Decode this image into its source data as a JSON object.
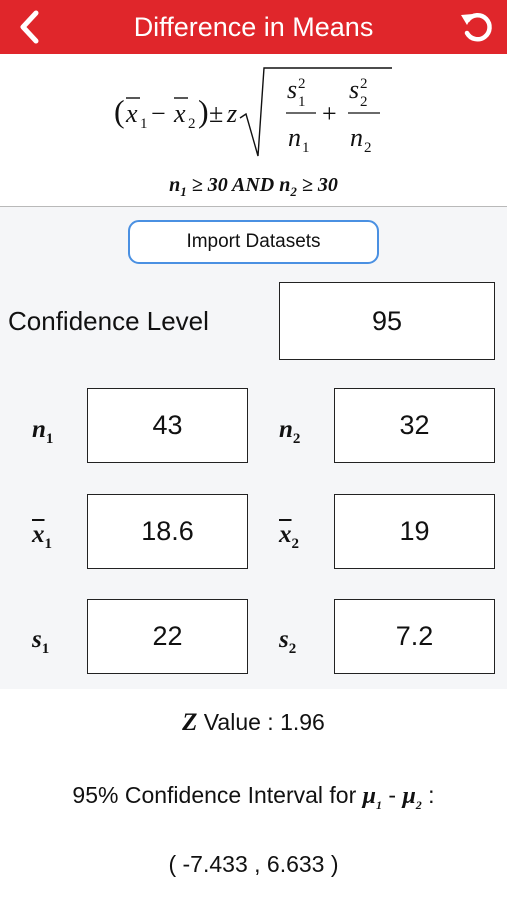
{
  "header": {
    "title": "Difference in Means"
  },
  "formula": {
    "condition_and": "AND",
    "condition_value": "30"
  },
  "import_button": "Import Datasets",
  "confidence": {
    "label": "Confidence Level",
    "value": "95"
  },
  "fields": {
    "n1": "43",
    "n2": "32",
    "x1": "18.6",
    "x2": "19",
    "s1": "22",
    "s2": "7.2"
  },
  "results": {
    "z_label": "Value : 1.96",
    "ci_label": "95% Confidence Interval for",
    "interval": "( -7.433 , 6.633 )"
  }
}
